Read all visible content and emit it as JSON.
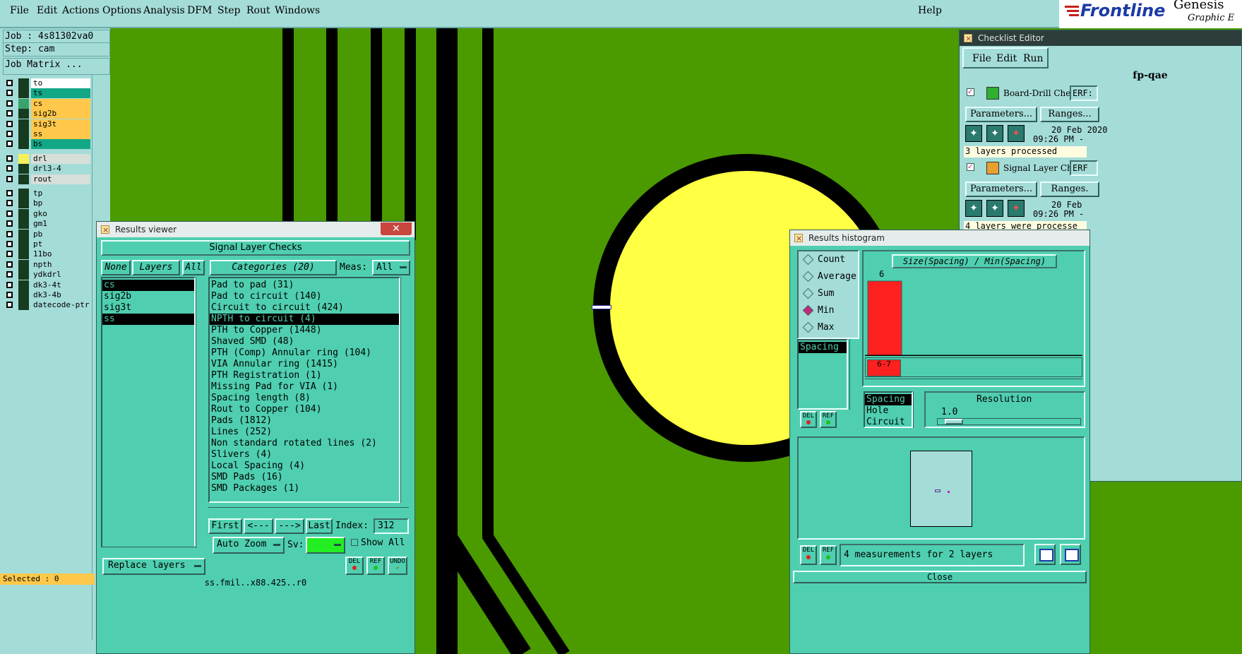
{
  "menu": [
    "File",
    "Edit",
    "Actions",
    "Options",
    "Analysis",
    "DFM",
    "Step",
    "Rout",
    "Windows"
  ],
  "help": "Help",
  "brand": {
    "logo": "Frontline",
    "product": "Genesis",
    "sub": "Graphic E"
  },
  "job": {
    "job": "Job : 4s81302va0",
    "step": "Step: cam",
    "matrix_btn": "Job Matrix ..."
  },
  "layers": [
    {
      "name": "to",
      "color": "#ffffff"
    },
    {
      "name": "ts",
      "color": "#12a887"
    },
    {
      "name": "cs",
      "color": "#ffc84a"
    },
    {
      "name": "sig2b",
      "color": "#ffc84a"
    },
    {
      "name": "sig3t",
      "color": "#ffc84a"
    },
    {
      "name": "ss",
      "color": "#ffc84a"
    },
    {
      "name": "bs",
      "color": "#12a887"
    },
    {
      "name": "drl",
      "color": "#d6dfd8"
    },
    {
      "name": "drl3-4",
      "color": "#a4dcd8"
    },
    {
      "name": "rout",
      "color": "#d6dfd8"
    },
    {
      "name": "tp",
      "color": "#a4dcd8"
    },
    {
      "name": "bp",
      "color": "#a4dcd8"
    },
    {
      "name": "gko",
      "color": "#a4dcd8"
    },
    {
      "name": "gm1",
      "color": "#a4dcd8"
    },
    {
      "name": "pb",
      "color": "#a4dcd8"
    },
    {
      "name": "pt",
      "color": "#a4dcd8"
    },
    {
      "name": "11bo",
      "color": "#a4dcd8"
    },
    {
      "name": "npth",
      "color": "#a4dcd8"
    },
    {
      "name": "ydkdrl",
      "color": "#a4dcd8"
    },
    {
      "name": "dk3-4t",
      "color": "#a4dcd8"
    },
    {
      "name": "dk3-4b",
      "color": "#a4dcd8"
    },
    {
      "name": "datecode-ptr",
      "color": "#a4dcd8"
    }
  ],
  "selected": "Selected : 0",
  "results_viewer": {
    "title": "Results viewer",
    "heading": "Signal Layer Checks",
    "none_btn": "None",
    "layers_btn": "Layers",
    "all_btn": "All",
    "categories_btn": "Categories (20)",
    "meas_label": "Meas:",
    "meas_value": "All",
    "layer_list": [
      "cs",
      "sig2b",
      "sig3t",
      "ss"
    ],
    "categories": [
      "Pad to pad (31)",
      "Pad to circuit (140)",
      "Circuit to circuit (424)",
      "NPTH to circuit (4)",
      "PTH to Copper (1448)",
      "Shaved SMD (48)",
      "PTH (Comp) Annular ring (104)",
      "VIA Annular ring (1415)",
      "PTH Registration (1)",
      "Missing Pad for VIA (1)",
      "Spacing length (8)",
      "Rout to Copper (104)",
      "Pads (1812)",
      "Lines (252)",
      "Non standard rotated lines (2)",
      "Slivers (4)",
      "Local Spacing (4)",
      "SMD Pads (16)",
      "SMD Packages (1)"
    ],
    "first_btn": "First",
    "prev_btn": "<---",
    "next_btn": "--->",
    "last_btn": "Last",
    "index_label": "Index:",
    "index_value": "312",
    "auto_zoom": "Auto Zoom",
    "sv_label": "Sv:",
    "show_all": "Show All",
    "replace_layers": "Replace layers",
    "del": "DEL",
    "ref": "REF",
    "undo": "UNDO",
    "status_fragment": "ss.fmil..x88.425..r0"
  },
  "checklist": {
    "title": "Checklist Editor",
    "menu": [
      "File",
      "Edit",
      "Run"
    ],
    "name": "fp-qae",
    "items": [
      {
        "label": "Board-Drill Che",
        "erf": "ERF:",
        "params": "Parameters...",
        "ranges": "Ranges...",
        "date": "20 Feb 2020",
        "time": "09:26 PM -",
        "status": "3 layers processed"
      },
      {
        "label": "Signal Layer Ch",
        "erf": "ERF",
        "params": "Parameters...",
        "ranges": "Ranges.",
        "date": "20 Feb",
        "time": "09:26 PM -",
        "status": "4 layers were processe"
      }
    ]
  },
  "histogram": {
    "title": "Results histogram",
    "modes": [
      "Count",
      "Average",
      "Sum",
      "Min",
      "Max"
    ],
    "selected_mode": "Min",
    "ratio_label": "Size(Spacing) / Min(Spacing)",
    "bar_value": "6",
    "bar_range": "6-7",
    "left_list": [
      "Spacing"
    ],
    "type_list": [
      "Spacing",
      "Hole",
      "Circuit"
    ],
    "resolution_label": "Resolution",
    "resolution_value": "1.0",
    "footer": "4 measurements for 2 layers",
    "close": "Close",
    "del": "DEL",
    "ref": "REF"
  }
}
